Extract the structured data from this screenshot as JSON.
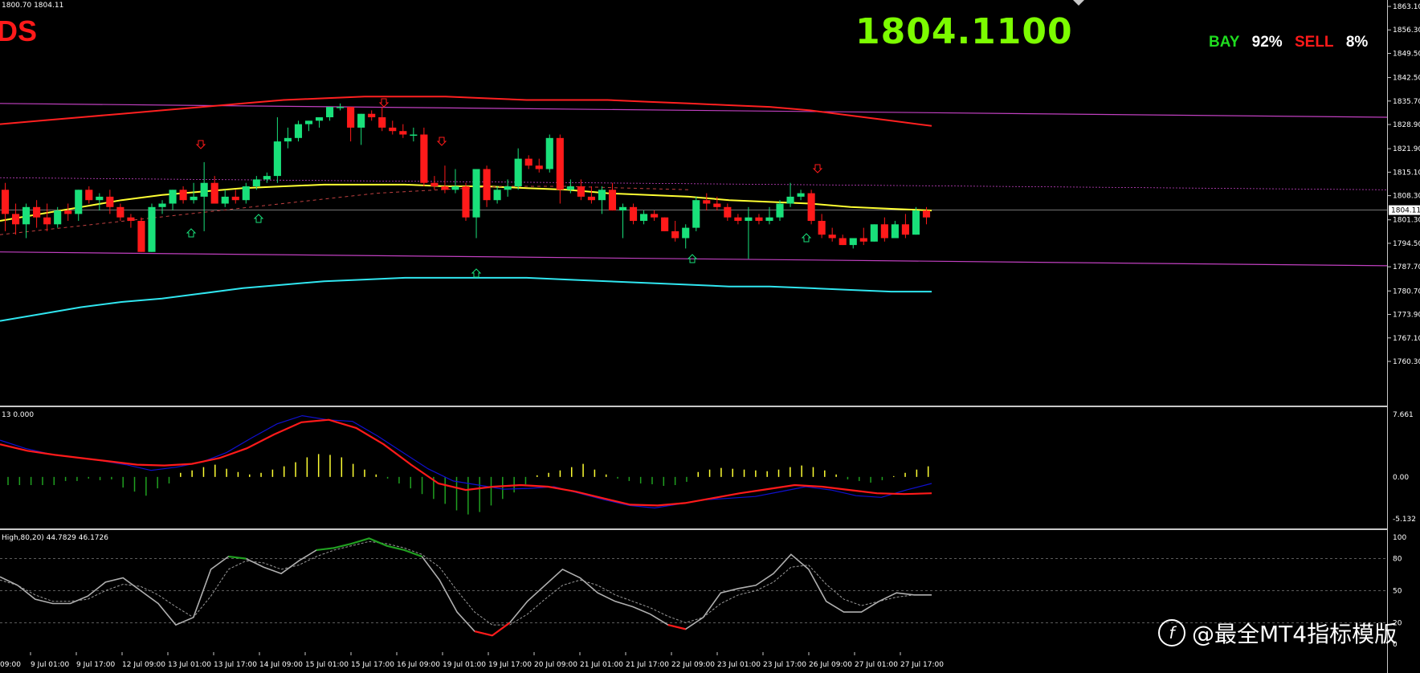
{
  "header": {
    "ohlc_text": "1800.70 1804.11",
    "symbol_fragment": "DS",
    "current_price": "1804.1100",
    "sentiment": {
      "buy_label": "BAY",
      "buy_pct": "92%",
      "sell_label": "SELL",
      "sell_pct": "8%"
    }
  },
  "price_axis": {
    "labels": [
      "1863.10",
      "1856.30",
      "1849.50",
      "1842.50",
      "1835.70",
      "1828.90",
      "1821.90",
      "1815.10",
      "1808.30",
      "1801.30",
      "1794.50",
      "1787.70",
      "1780.70",
      "1773.90",
      "1767.10",
      "1760.30"
    ],
    "current_tag": "1804.11"
  },
  "macd": {
    "label": "13 0.000",
    "axis_labels": [
      "7.661",
      "0.00",
      "-5.132"
    ]
  },
  "stochastic": {
    "label": "High,80,20) 44.7829 46.1726",
    "axis_labels": [
      "100",
      "80",
      "50",
      "20",
      "0"
    ]
  },
  "time_axis": {
    "labels": [
      "9 Jul 01:00",
      "9 Jul 17:00",
      "12 Jul 09:00",
      "13 Jul 01:00",
      "13 Jul 17:00",
      "14 Jul 09:00",
      "15 Jul 01:00",
      "15 Jul 17:00",
      "16 Jul 09:00",
      "19 Jul 01:00",
      "19 Jul 17:00",
      "20 Jul 09:00",
      "21 Jul 01:00",
      "21 Jul 17:00",
      "22 Jul 09:00",
      "23 Jul 01:00",
      "23 Jul 17:00",
      "26 Jul 09:00",
      "27 Jul 01:00",
      "27 Jul 17:00"
    ],
    "first_partial": "09:00"
  },
  "watermark": "@最全MT4指标模版",
  "colors": {
    "bull": "#19e07a",
    "bear": "#ff1a1a",
    "ma": "#ffff33",
    "upper_band": "#ff2020",
    "lower_band": "#30e6f0",
    "channel": "#c040c0",
    "macd_main": "#1010d0",
    "macd_signal": "#ff1a1a",
    "stoch_main": "#b0b0b0",
    "stoch_ob": "#20a020",
    "stoch_os": "#ff1a1a"
  },
  "chart_data": {
    "type": "candlestick",
    "candles": [
      {
        "o": 1810,
        "h": 1812,
        "l": 1798,
        "c": 1803
      },
      {
        "o": 1803,
        "h": 1806,
        "l": 1797,
        "c": 1800
      },
      {
        "o": 1800,
        "h": 1806,
        "l": 1796,
        "c": 1805
      },
      {
        "o": 1805,
        "h": 1807,
        "l": 1799,
        "c": 1802
      },
      {
        "o": 1802,
        "h": 1806,
        "l": 1798,
        "c": 1800
      },
      {
        "o": 1800,
        "h": 1805,
        "l": 1799,
        "c": 1804
      },
      {
        "o": 1804,
        "h": 1806,
        "l": 1801,
        "c": 1803
      },
      {
        "o": 1803,
        "h": 1810,
        "l": 1801,
        "c": 1810
      },
      {
        "o": 1810,
        "h": 1811,
        "l": 1806,
        "c": 1807
      },
      {
        "o": 1807,
        "h": 1809,
        "l": 1804,
        "c": 1808
      },
      {
        "o": 1808,
        "h": 1810,
        "l": 1803,
        "c": 1805
      },
      {
        "o": 1805,
        "h": 1806,
        "l": 1801,
        "c": 1802
      },
      {
        "o": 1802,
        "h": 1803,
        "l": 1799,
        "c": 1801
      },
      {
        "o": 1801,
        "h": 1802,
        "l": 1792,
        "c": 1792
      },
      {
        "o": 1792,
        "h": 1806,
        "l": 1792,
        "c": 1805
      },
      {
        "o": 1805,
        "h": 1807,
        "l": 1803,
        "c": 1806
      },
      {
        "o": 1806,
        "h": 1810,
        "l": 1804,
        "c": 1810
      },
      {
        "o": 1810,
        "h": 1811,
        "l": 1806,
        "c": 1807
      },
      {
        "o": 1807,
        "h": 1812,
        "l": 1806,
        "c": 1808
      },
      {
        "o": 1808,
        "h": 1818,
        "l": 1798,
        "c": 1812
      },
      {
        "o": 1812,
        "h": 1814,
        "l": 1806,
        "c": 1806
      },
      {
        "o": 1806,
        "h": 1810,
        "l": 1805,
        "c": 1808
      },
      {
        "o": 1808,
        "h": 1810,
        "l": 1806,
        "c": 1807
      },
      {
        "o": 1807,
        "h": 1812,
        "l": 1806,
        "c": 1811
      },
      {
        "o": 1811,
        "h": 1814,
        "l": 1810,
        "c": 1813
      },
      {
        "o": 1813,
        "h": 1815,
        "l": 1812,
        "c": 1814
      },
      {
        "o": 1814,
        "h": 1831,
        "l": 1812,
        "c": 1824
      },
      {
        "o": 1824,
        "h": 1828,
        "l": 1822,
        "c": 1825
      },
      {
        "o": 1825,
        "h": 1830,
        "l": 1824,
        "c": 1829
      },
      {
        "o": 1829,
        "h": 1830,
        "l": 1827,
        "c": 1830
      },
      {
        "o": 1830,
        "h": 1831,
        "l": 1828,
        "c": 1831
      },
      {
        "o": 1831,
        "h": 1834,
        "l": 1830,
        "c": 1834
      },
      {
        "o": 1834,
        "h": 1835,
        "l": 1833,
        "c": 1834
      },
      {
        "o": 1834,
        "h": 1834,
        "l": 1824,
        "c": 1828
      },
      {
        "o": 1828,
        "h": 1832,
        "l": 1823,
        "c": 1832
      },
      {
        "o": 1832,
        "h": 1833,
        "l": 1830,
        "c": 1831
      },
      {
        "o": 1831,
        "h": 1834,
        "l": 1827,
        "c": 1828
      },
      {
        "o": 1828,
        "h": 1830,
        "l": 1826,
        "c": 1827
      },
      {
        "o": 1827,
        "h": 1829,
        "l": 1825,
        "c": 1826
      },
      {
        "o": 1826,
        "h": 1828,
        "l": 1824,
        "c": 1826
      },
      {
        "o": 1826,
        "h": 1828,
        "l": 1811,
        "c": 1812
      },
      {
        "o": 1812,
        "h": 1814,
        "l": 1810,
        "c": 1811
      },
      {
        "o": 1811,
        "h": 1817,
        "l": 1809,
        "c": 1810
      },
      {
        "o": 1810,
        "h": 1816,
        "l": 1809,
        "c": 1811
      },
      {
        "o": 1811,
        "h": 1812,
        "l": 1801,
        "c": 1802
      },
      {
        "o": 1802,
        "h": 1816,
        "l": 1796,
        "c": 1816
      },
      {
        "o": 1816,
        "h": 1817,
        "l": 1805,
        "c": 1807
      },
      {
        "o": 1807,
        "h": 1811,
        "l": 1806,
        "c": 1810
      },
      {
        "o": 1810,
        "h": 1813,
        "l": 1808,
        "c": 1811
      },
      {
        "o": 1811,
        "h": 1822,
        "l": 1810,
        "c": 1819
      },
      {
        "o": 1819,
        "h": 1820,
        "l": 1816,
        "c": 1817
      },
      {
        "o": 1817,
        "h": 1819,
        "l": 1815,
        "c": 1816
      },
      {
        "o": 1816,
        "h": 1826,
        "l": 1815,
        "c": 1825
      },
      {
        "o": 1825,
        "h": 1826,
        "l": 1806,
        "c": 1810
      },
      {
        "o": 1810,
        "h": 1813,
        "l": 1809,
        "c": 1811
      },
      {
        "o": 1811,
        "h": 1813,
        "l": 1807,
        "c": 1808
      },
      {
        "o": 1808,
        "h": 1811,
        "l": 1806,
        "c": 1807
      },
      {
        "o": 1807,
        "h": 1811,
        "l": 1803,
        "c": 1810
      },
      {
        "o": 1810,
        "h": 1812,
        "l": 1804,
        "c": 1804
      },
      {
        "o": 1804,
        "h": 1806,
        "l": 1796,
        "c": 1805
      },
      {
        "o": 1805,
        "h": 1806,
        "l": 1800,
        "c": 1801
      },
      {
        "o": 1801,
        "h": 1804,
        "l": 1800,
        "c": 1803
      },
      {
        "o": 1803,
        "h": 1804,
        "l": 1801,
        "c": 1802
      },
      {
        "o": 1802,
        "h": 1802,
        "l": 1798,
        "c": 1798
      },
      {
        "o": 1798,
        "h": 1801,
        "l": 1795,
        "c": 1796
      },
      {
        "o": 1796,
        "h": 1800,
        "l": 1793,
        "c": 1799
      },
      {
        "o": 1799,
        "h": 1808,
        "l": 1798,
        "c": 1807
      },
      {
        "o": 1807,
        "h": 1809,
        "l": 1804,
        "c": 1806
      },
      {
        "o": 1806,
        "h": 1808,
        "l": 1804,
        "c": 1805
      },
      {
        "o": 1805,
        "h": 1806,
        "l": 1801,
        "c": 1802
      },
      {
        "o": 1802,
        "h": 1803,
        "l": 1800,
        "c": 1801
      },
      {
        "o": 1801,
        "h": 1805,
        "l": 1790,
        "c": 1802
      },
      {
        "o": 1802,
        "h": 1803,
        "l": 1800,
        "c": 1801
      },
      {
        "o": 1801,
        "h": 1805,
        "l": 1800,
        "c": 1802
      },
      {
        "o": 1802,
        "h": 1807,
        "l": 1801,
        "c": 1806
      },
      {
        "o": 1806,
        "h": 1812,
        "l": 1805,
        "c": 1808
      },
      {
        "o": 1808,
        "h": 1810,
        "l": 1807,
        "c": 1809
      },
      {
        "o": 1809,
        "h": 1810,
        "l": 1800,
        "c": 1801
      },
      {
        "o": 1801,
        "h": 1803,
        "l": 1796,
        "c": 1797
      },
      {
        "o": 1797,
        "h": 1799,
        "l": 1795,
        "c": 1796
      },
      {
        "o": 1796,
        "h": 1797,
        "l": 1794,
        "c": 1794
      },
      {
        "o": 1794,
        "h": 1796,
        "l": 1793,
        "c": 1796
      },
      {
        "o": 1796,
        "h": 1799,
        "l": 1794,
        "c": 1795
      },
      {
        "o": 1795,
        "h": 1800,
        "l": 1795,
        "c": 1800
      },
      {
        "o": 1800,
        "h": 1802,
        "l": 1795,
        "c": 1796
      },
      {
        "o": 1796,
        "h": 1801,
        "l": 1796,
        "c": 1800
      },
      {
        "o": 1800,
        "h": 1803,
        "l": 1796,
        "c": 1797
      },
      {
        "o": 1797,
        "h": 1805,
        "l": 1797,
        "c": 1804
      },
      {
        "o": 1804,
        "h": 1805,
        "l": 1800,
        "c": 1802
      }
    ],
    "upper_band": [
      1829,
      1830,
      1831,
      1832,
      1833,
      1834,
      1835,
      1836,
      1836.5,
      1837,
      1837,
      1837,
      1836.5,
      1836,
      1836,
      1836,
      1835.5,
      1835,
      1834.5,
      1834,
      1833,
      1831.5,
      1830,
      1828.5
    ],
    "middle_ma": [
      1801,
      1803,
      1805,
      1807,
      1808.5,
      1809.5,
      1810.5,
      1811,
      1811.5,
      1811.5,
      1811.5,
      1811,
      1811,
      1810.5,
      1810,
      1809,
      1808.5,
      1808,
      1807,
      1806.5,
      1806,
      1805,
      1804.5,
      1804
    ],
    "lower_band": [
      1772,
      1774,
      1776,
      1777.5,
      1778.5,
      1780,
      1781.5,
      1782.5,
      1783.5,
      1784,
      1784.5,
      1784.5,
      1784.5,
      1784.5,
      1784,
      1783.5,
      1783,
      1782.5,
      1782,
      1782,
      1781.5,
      1781,
      1780.5,
      1780.5
    ],
    "channel_top": [
      1835,
      1831
    ],
    "channel_bottom": [
      1792,
      1788
    ],
    "macd_hist": [
      -1.0,
      -1.0,
      -1.0,
      -1.0,
      -1.0,
      -0.5,
      -0.5,
      -0.2,
      -0.4,
      -0.3,
      -1.3,
      -1.8,
      -2.3,
      -1.4,
      -0.8,
      0.5,
      0.8,
      1.2,
      1.5,
      1.0,
      0.6,
      0.3,
      0.5,
      0.9,
      1.3,
      1.8,
      2.4,
      2.8,
      2.7,
      2.4,
      1.6,
      0.9,
      0.3,
      -0.2,
      -0.8,
      -1.4,
      -2.1,
      -2.7,
      -3.3,
      -4.1,
      -4.6,
      -4.3,
      -3.5,
      -2.7,
      -1.9,
      -0.9,
      0.2,
      0.5,
      0.8,
      1.2,
      1.6,
      0.9,
      0.3,
      -0.2,
      -0.5,
      -0.8,
      -0.9,
      -1.1,
      -1.0,
      -0.6,
      0.6,
      0.9,
      1.1,
      1.0,
      0.9,
      0.8,
      0.7,
      0.9,
      1.2,
      1.4,
      1.2,
      0.8,
      0.3,
      -0.3,
      -0.5,
      -0.7,
      -0.4,
      0.1,
      0.5,
      0.9,
      1.3
    ],
    "macd_main": [
      4.5,
      3.5,
      2.8,
      2.4,
      2.0,
      1.5,
      0.8,
      1.2,
      1.8,
      3.0,
      4.8,
      6.5,
      7.5,
      7.0,
      6.8,
      5.0,
      3.0,
      1.0,
      -0.5,
      -1.0,
      -1.5,
      -1.4,
      -1.2,
      -2.0,
      -2.8,
      -3.5,
      -3.8,
      -3.3,
      -2.8,
      -2.6,
      -2.4,
      -1.8,
      -1.2,
      -1.6,
      -2.3,
      -2.5,
      -1.6,
      -0.8
    ],
    "macd_signal": [
      4.0,
      3.2,
      2.7,
      2.3,
      1.9,
      1.5,
      1.4,
      1.6,
      2.3,
      3.5,
      5.2,
      6.7,
      7.0,
      6.0,
      4.0,
      1.5,
      -0.8,
      -1.6,
      -1.2,
      -1.0,
      -1.2,
      -1.8,
      -2.6,
      -3.4,
      -3.5,
      -3.2,
      -2.6,
      -2.0,
      -1.5,
      -1.0,
      -1.2,
      -1.6,
      -2.0,
      -2.1,
      -2.0
    ],
    "stoch_main": [
      63,
      55,
      42,
      38,
      38,
      45,
      58,
      62,
      50,
      38,
      18,
      25,
      70,
      82,
      80,
      72,
      66,
      78,
      88,
      90,
      94,
      99,
      92,
      88,
      82,
      60,
      30,
      12,
      8,
      20,
      40,
      55,
      70,
      62,
      48,
      40,
      35,
      28,
      18,
      14,
      25,
      48,
      52,
      55,
      66,
      84,
      70,
      40,
      30,
      30,
      40,
      48,
      46,
      46
    ],
    "stoch_signal": [
      60,
      55,
      46,
      40,
      40,
      42,
      50,
      56,
      54,
      46,
      35,
      25,
      45,
      70,
      78,
      76,
      70,
      74,
      82,
      88,
      92,
      96,
      94,
      90,
      84,
      72,
      50,
      30,
      18,
      18,
      28,
      42,
      55,
      60,
      55,
      46,
      40,
      34,
      26,
      20,
      25,
      38,
      46,
      50,
      58,
      72,
      74,
      56,
      42,
      36,
      40,
      44,
      46,
      46
    ],
    "price_range": [
      1760.3,
      1863.1
    ],
    "macd_range": [
      -5.132,
      7.661
    ],
    "stoch_levels": [
      80,
      50,
      20
    ]
  }
}
